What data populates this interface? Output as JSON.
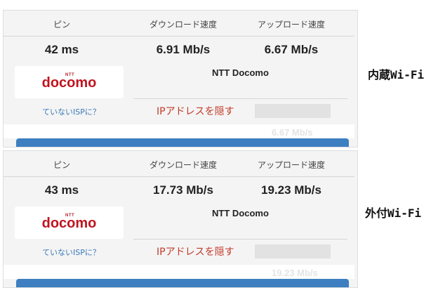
{
  "panels": [
    {
      "headers": {
        "ping": "ピン",
        "download": "ダウンロード速度",
        "upload": "アップロード速度"
      },
      "values": {
        "ping": "42 ms",
        "download": "6.91 Mb/s",
        "upload": "6.67 Mb/s"
      },
      "logo": {
        "small": "NTT",
        "word": "docomo"
      },
      "isp_name": "NTT Docomo",
      "isp_link": "ていないISPに？",
      "hide_ip": "IPアドレスを隠す",
      "ghost_text": "6.67 Mb/s",
      "side_label": "内蔵Wi-Fi"
    },
    {
      "headers": {
        "ping": "ピン",
        "download": "ダウンロード速度",
        "upload": "アップロード速度"
      },
      "values": {
        "ping": "43 ms",
        "download": "17.73 Mb/s",
        "upload": "19.23 Mb/s"
      },
      "logo": {
        "small": "NTT",
        "word": "docomo"
      },
      "isp_name": "NTT Docomo",
      "isp_link": "ていないISPに？",
      "hide_ip": "IPアドレスを隠す",
      "ghost_text": "19.23 Mb/s",
      "side_label": "外付Wi-Fi"
    }
  ],
  "colors": {
    "accent_bar": "#3d7fc0",
    "hide_ip_text": "#c23a2a",
    "link_text": "#3a78b8",
    "logo_red": "#c0141f"
  }
}
